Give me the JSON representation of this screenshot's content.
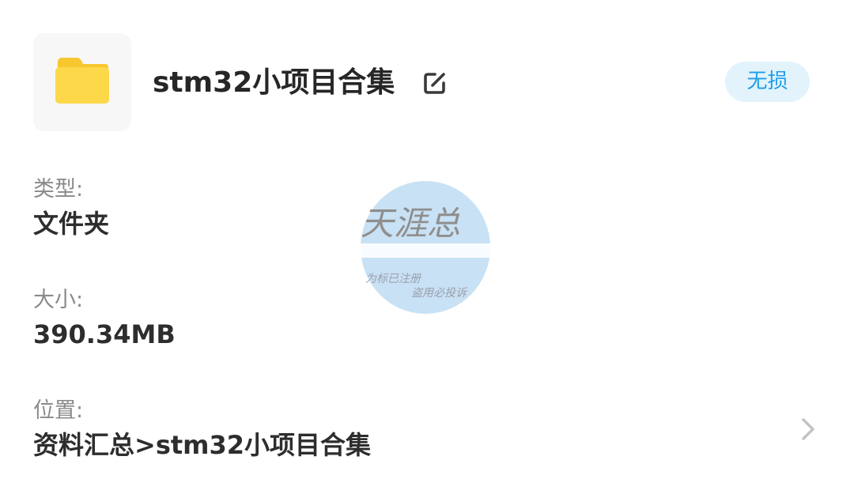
{
  "header": {
    "file_name": "stm32小项目合集",
    "badge": "无损",
    "folder_icon": "folder-icon",
    "edit_icon": "edit-icon",
    "folder_color": "#fdd33f",
    "badge_color": "#1f9ee8"
  },
  "details": {
    "type_label": "类型:",
    "type_value": "文件夹",
    "size_label": "大小:",
    "size_value": "390.34MB",
    "location_label": "位置:",
    "location_value": "资料汇总>stm32小项目合集",
    "chevron_icon": "chevron-right-icon"
  },
  "watermark": {
    "main_text": "天涯总",
    "sub_line1": "为标已注册",
    "sub_line2": "盗用必投诉"
  }
}
